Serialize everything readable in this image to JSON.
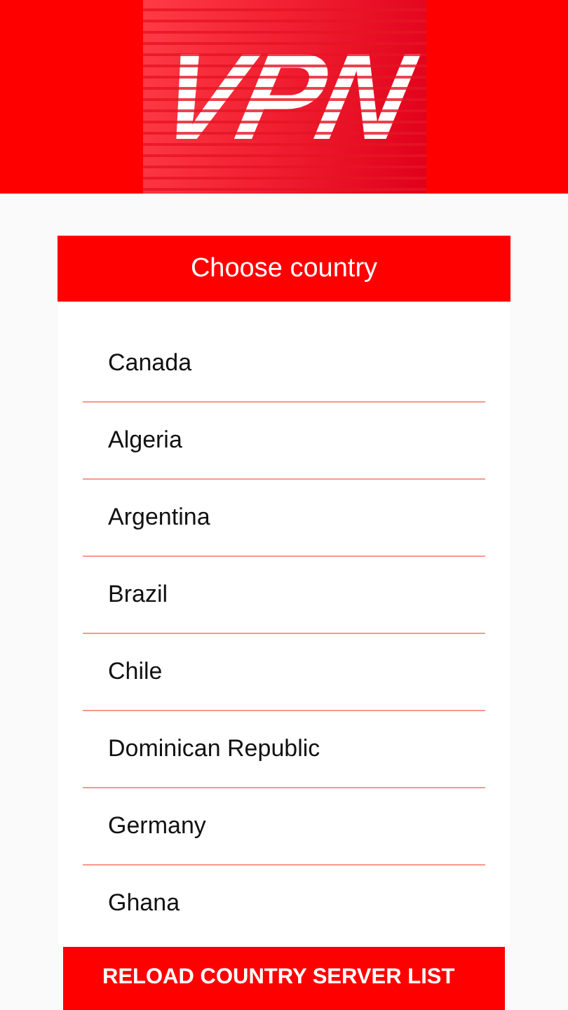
{
  "logo": {
    "text": "VPN"
  },
  "panel": {
    "title": "Choose country",
    "countries": [
      {
        "name": "Canada"
      },
      {
        "name": "Algeria"
      },
      {
        "name": "Argentina"
      },
      {
        "name": "Brazil"
      },
      {
        "name": "Chile"
      },
      {
        "name": "Dominican Republic"
      },
      {
        "name": "Germany"
      },
      {
        "name": "Ghana"
      }
    ]
  },
  "reload_button": {
    "label": "RELOAD COUNTRY SERVER LIST"
  }
}
